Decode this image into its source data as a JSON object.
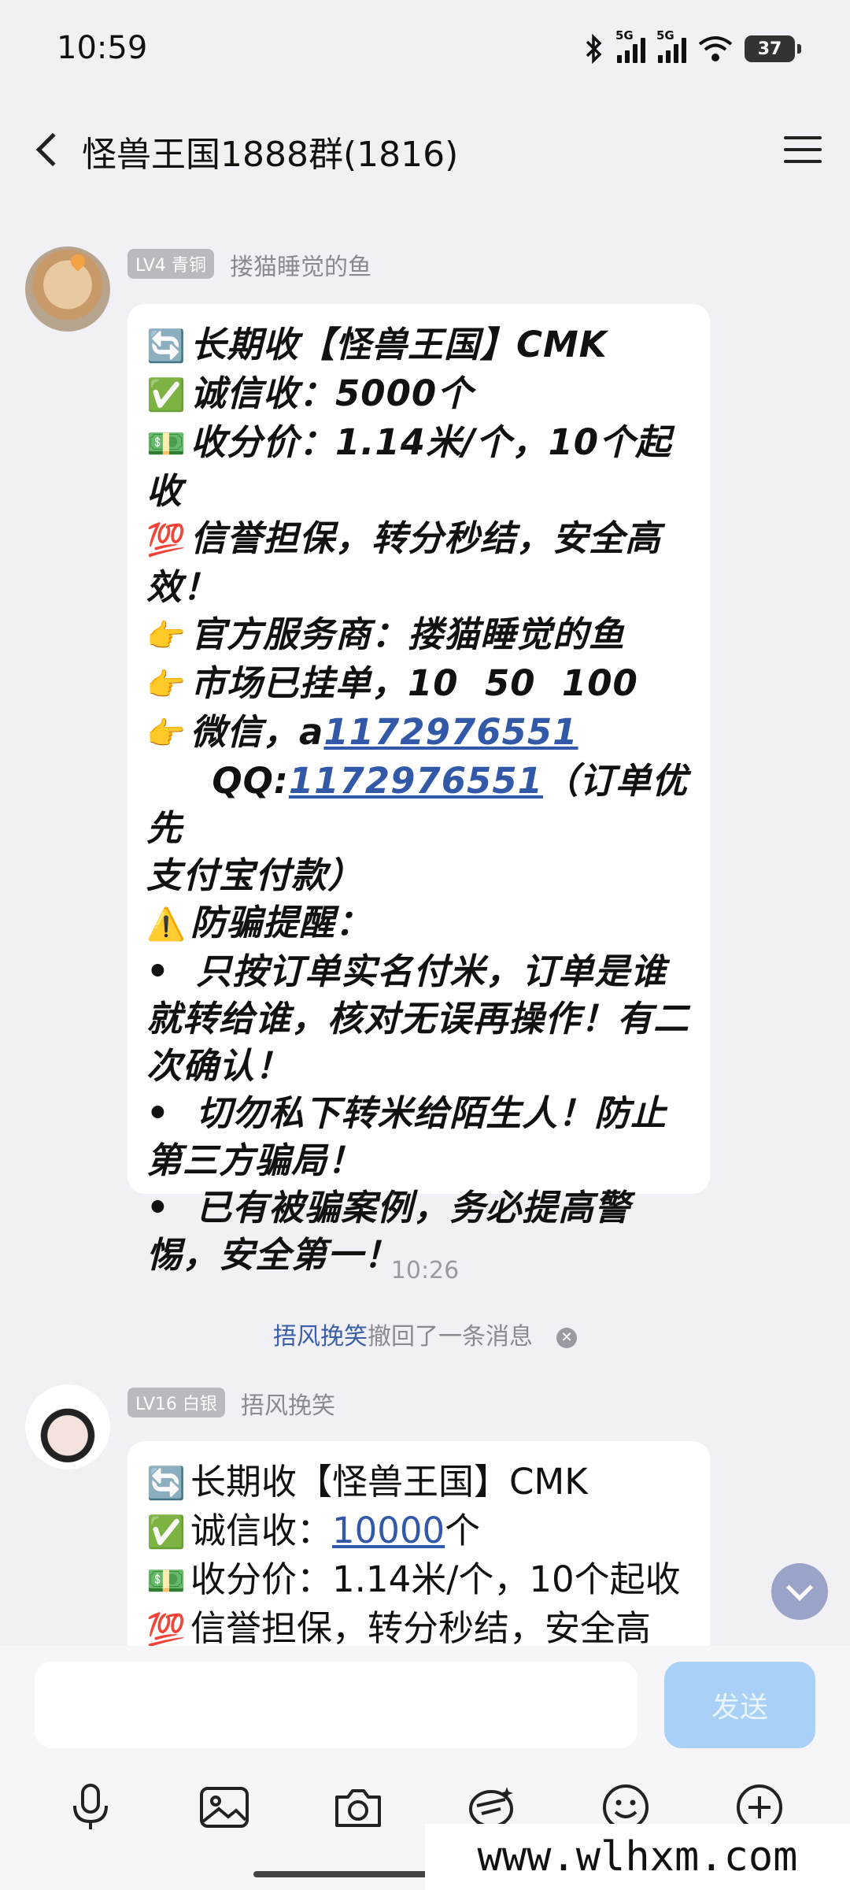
{
  "status": {
    "time": "10:59",
    "net1": "5G",
    "net2": "5G",
    "battery": "37"
  },
  "header": {
    "title": "怪兽王国1888群(1816)"
  },
  "messages": [
    {
      "level": "LV4 青铜",
      "sender": "搂猫睡觉的鱼",
      "lines": [
        {
          "emoji": "🔄",
          "text": "长期收【怪兽王国】CMK"
        },
        {
          "emoji": "✅",
          "text": "诚信收：5000个"
        },
        {
          "emoji": "💵",
          "text": "收分价：1.14米/个，10个起收"
        },
        {
          "emoji": "💯",
          "text": "信誉担保，转分秒结，安全高"
        },
        {
          "emoji": "",
          "text": "效！"
        },
        {
          "emoji": "👉",
          "text": "官方服务商：搂猫睡觉的鱼"
        },
        {
          "emoji": "👉",
          "text": "市场已挂单，10  50  100"
        },
        {
          "emoji": "👉",
          "text": "微信，a",
          "link": "1172976551"
        },
        {
          "emoji": "",
          "text": "     QQ:",
          "link": "1172976551",
          "after": "（订单优先"
        },
        {
          "emoji": "",
          "text": "支付宝付款）"
        },
        {
          "emoji": "⚠️",
          "text": "防骗提醒："
        },
        {
          "emoji": "",
          "text": "•  只按订单实名付米，订单是谁"
        },
        {
          "emoji": "",
          "text": "就转给谁，核对无误再操作！有二"
        },
        {
          "emoji": "",
          "text": "次确认！"
        },
        {
          "emoji": "",
          "text": "•  切勿私下转米给陌生人！防止"
        },
        {
          "emoji": "",
          "text": "第三方骗局！"
        },
        {
          "emoji": "",
          "text": "•  已有被骗案例，务必提高警"
        },
        {
          "emoji": "",
          "text": "惕，安全第一！"
        }
      ]
    },
    {
      "level": "LV16 白银",
      "sender": "捂风挽笑",
      "lines": [
        {
          "emoji": "🔄",
          "text": "长期收【怪兽王国】CMK"
        },
        {
          "emoji": "✅",
          "text": "诚信收：",
          "link": "10000",
          "after": "个"
        },
        {
          "emoji": "💵",
          "text": "收分价：1.14米/个，10个起收"
        },
        {
          "emoji": "💯",
          "text": "信誉担保，转分秒结，安全高"
        }
      ]
    }
  ],
  "time_divider": "10:26",
  "recall": {
    "who": "捂风挽笑",
    "text": "撤回了一条消息"
  },
  "input": {
    "placeholder": "",
    "send_label": "发送"
  },
  "toolbar": [
    "mic-icon",
    "image-icon",
    "camera-icon",
    "hongbao-icon",
    "emoji-icon",
    "plus-icon"
  ],
  "watermark": "www.wlhxm.com"
}
